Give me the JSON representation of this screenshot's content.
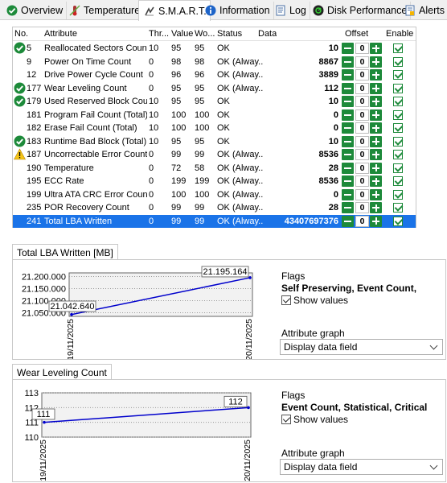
{
  "tabs": [
    {
      "label": "Overview",
      "icon": "check-circle-icon"
    },
    {
      "label": "Temperature",
      "icon": "thermometer-icon"
    },
    {
      "label": "S.M.A.R.T.",
      "icon": "smart-icon",
      "active": true
    },
    {
      "label": "Information",
      "icon": "info-icon"
    },
    {
      "label": "Log",
      "icon": "log-icon"
    },
    {
      "label": "Disk Performance",
      "icon": "disk-performance-icon"
    },
    {
      "label": "Alerts",
      "icon": "alerts-icon"
    }
  ],
  "smart_table": {
    "headers": [
      "No.",
      "Attribute",
      "Thr...",
      "Value",
      "Wo...",
      "Status",
      "Data",
      "Offset",
      "Enable"
    ],
    "rows": [
      {
        "status_icon": "ok",
        "no": "5",
        "attribute": "Reallocated Sectors Count",
        "thr": "10",
        "value": "95",
        "worst": "95",
        "status": "OK",
        "data": "10",
        "offset": "0"
      },
      {
        "status_icon": "",
        "no": "9",
        "attribute": "Power On Time Count",
        "thr": "0",
        "value": "98",
        "worst": "98",
        "status": "OK (Alway...",
        "data": "8867",
        "offset": "0"
      },
      {
        "status_icon": "",
        "no": "12",
        "attribute": "Drive Power Cycle Count",
        "thr": "0",
        "value": "96",
        "worst": "96",
        "status": "OK (Alway...",
        "data": "3889",
        "offset": "0"
      },
      {
        "status_icon": "ok",
        "no": "177",
        "attribute": "Wear Leveling Count",
        "thr": "0",
        "value": "95",
        "worst": "95",
        "status": "OK (Alway...",
        "data": "112",
        "offset": "0"
      },
      {
        "status_icon": "ok",
        "no": "179",
        "attribute": "Used Reserved Block Count...",
        "thr": "10",
        "value": "95",
        "worst": "95",
        "status": "OK",
        "data": "10",
        "offset": "0"
      },
      {
        "status_icon": "",
        "no": "181",
        "attribute": "Program Fail Count (Total)",
        "thr": "10",
        "value": "100",
        "worst": "100",
        "status": "OK",
        "data": "0",
        "offset": "0"
      },
      {
        "status_icon": "",
        "no": "182",
        "attribute": "Erase Fail Count (Total)",
        "thr": "10",
        "value": "100",
        "worst": "100",
        "status": "OK",
        "data": "0",
        "offset": "0"
      },
      {
        "status_icon": "ok",
        "no": "183",
        "attribute": "Runtime Bad Block (Total)",
        "thr": "10",
        "value": "95",
        "worst": "95",
        "status": "OK",
        "data": "10",
        "offset": "0"
      },
      {
        "status_icon": "warning",
        "no": "187",
        "attribute": "Uncorrectable Error Count",
        "thr": "0",
        "value": "99",
        "worst": "99",
        "status": "OK (Alway...",
        "data": "8536",
        "offset": "0"
      },
      {
        "status_icon": "",
        "no": "190",
        "attribute": "Temperature",
        "thr": "0",
        "value": "72",
        "worst": "58",
        "status": "OK (Alway...",
        "data": "28",
        "offset": "0"
      },
      {
        "status_icon": "",
        "no": "195",
        "attribute": "ECC Rate",
        "thr": "0",
        "value": "199",
        "worst": "199",
        "status": "OK (Alway...",
        "data": "8536",
        "offset": "0"
      },
      {
        "status_icon": "",
        "no": "199",
        "attribute": "Ultra ATA CRC Error Count",
        "thr": "0",
        "value": "100",
        "worst": "100",
        "status": "OK (Alway...",
        "data": "0",
        "offset": "0"
      },
      {
        "status_icon": "",
        "no": "235",
        "attribute": "POR Recovery Count",
        "thr": "0",
        "value": "99",
        "worst": "99",
        "status": "OK (Alway...",
        "data": "28",
        "offset": "0"
      },
      {
        "status_icon": "",
        "no": "241",
        "attribute": "Total LBA Written",
        "thr": "0",
        "value": "99",
        "worst": "99",
        "status": "OK (Alway...",
        "data": "43407697376",
        "offset": "0",
        "selected": true
      }
    ]
  },
  "graph1": {
    "tab_label": "Total LBA Written [MB]",
    "flags_label": "Flags",
    "flags_value": "Self Preserving, Event Count,",
    "show_values_label": "Show values",
    "attribute_graph_label": "Attribute graph",
    "attribute_graph_value": "Display data field",
    "chart_data": {
      "type": "line",
      "x": [
        "19/11/2025",
        "20/11/2025"
      ],
      "values": [
        21042640,
        21195164
      ],
      "point_labels": [
        "21.042.640",
        "21.195.164"
      ],
      "y_ticks": [
        "21.200.000",
        "21.150.000",
        "21.100.000",
        "21.050.000"
      ],
      "y_tick_values": [
        21200000,
        21150000,
        21100000,
        21050000
      ],
      "ylim": [
        21035000,
        21215000
      ],
      "grid": true,
      "line_color": "#0000cc"
    }
  },
  "graph2": {
    "tab_label": "Wear Leveling Count",
    "flags_label": "Flags",
    "flags_value": "Event Count, Statistical, Critical",
    "show_values_label": "Show values",
    "attribute_graph_label": "Attribute graph",
    "attribute_graph_value": "Display data field",
    "chart_data": {
      "type": "line",
      "x": [
        "19/11/2025",
        "20/11/2025"
      ],
      "values": [
        111,
        112
      ],
      "point_labels": [
        "111",
        "112"
      ],
      "y_ticks": [
        "113",
        "112",
        "111",
        "110"
      ],
      "y_tick_values": [
        113,
        112,
        111,
        110
      ],
      "ylim": [
        110,
        113
      ],
      "grid": true,
      "line_color": "#0000cc"
    }
  }
}
